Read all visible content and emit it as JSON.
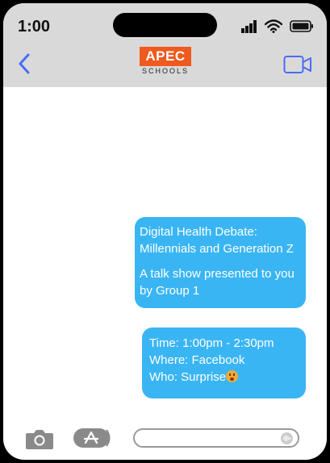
{
  "status_bar": {
    "time": "1:00"
  },
  "header": {
    "logo_top": "APEC",
    "logo_bottom": "SCHOOLS"
  },
  "messages": [
    {
      "lines": [
        "Digital Health Debate: Millennials and Generation Z",
        "A talk show presented to you by Group 1"
      ]
    },
    {
      "lines": [
        "Time: 1:00pm - 2:30pm",
        "Where: Facebook",
        "Who: Surprise"
      ]
    }
  ],
  "icons": {
    "back": "chevron-left-icon",
    "video": "video-camera-icon",
    "camera": "camera-icon",
    "appstore": "app-store-icon",
    "emoji": "astonished-face-emoji-icon",
    "mic": "microphone-icon"
  },
  "colors": {
    "bubble": "#3ab5f4",
    "accent": "#4a6cf7",
    "logo": "#ef5a1e",
    "header_bg": "#d9d9d9"
  }
}
